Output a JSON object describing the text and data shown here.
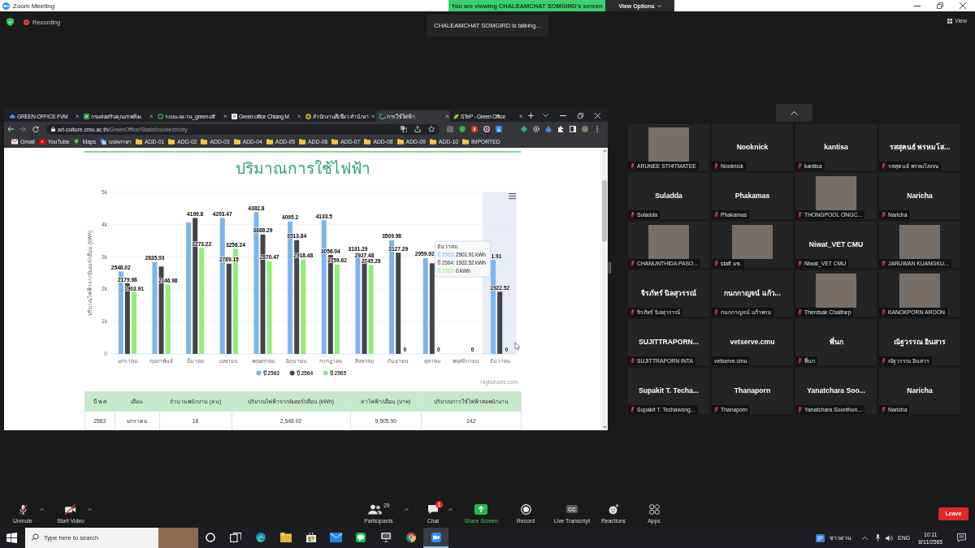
{
  "window": {
    "title": "Zoom Meeting"
  },
  "share_banner": {
    "text": "You are viewing CHALEAMCHAT SOMGIRD's screen",
    "view_options": "View Options"
  },
  "meeting_bar": {
    "recording": "Recording",
    "talking": "CHALEAMCHAT SOMGIRD is talking...",
    "view": "View"
  },
  "browser": {
    "tabs": [
      {
        "title": "GREEN OFFICE FVM",
        "selected": false
      },
      {
        "title": "กรมส่งเสริมคุณภาพสิ่งแ",
        "selected": false
      },
      {
        "title": "ระบบ-ลง-วน_green-off",
        "selected": false
      },
      {
        "title": "Green office Chiang M",
        "selected": false
      },
      {
        "title": "สำนักงานสีเขียว สำนักงา",
        "selected": false
      },
      {
        "title": "การใช้ไฟฟ้า",
        "selected": true
      },
      {
        "title": "STeP - Green Office",
        "selected": false
      }
    ],
    "address": {
      "host": "art-culture.cmu.ac.th",
      "path": "/GreenOffice/Statistics/electricity"
    },
    "bookmarks": [
      {
        "label": "Gmail",
        "kind": "mail"
      },
      {
        "label": "YouTube",
        "kind": "video"
      },
      {
        "label": "Maps",
        "kind": "map"
      },
      {
        "label": "แปลภาษา",
        "kind": "translate"
      },
      {
        "label": "ADD-01",
        "kind": "folder"
      },
      {
        "label": "ADD-02",
        "kind": "folder"
      },
      {
        "label": "ADD-03",
        "kind": "folder"
      },
      {
        "label": "ADD-04",
        "kind": "folder"
      },
      {
        "label": "ADD-05",
        "kind": "folder"
      },
      {
        "label": "ADD-06",
        "kind": "folder"
      },
      {
        "label": "ADD-07",
        "kind": "folder"
      },
      {
        "label": "ADD-08",
        "kind": "folder"
      },
      {
        "label": "ADD-09",
        "kind": "folder"
      },
      {
        "label": "ADD-10",
        "kind": "folder"
      },
      {
        "label": "IMPORTED",
        "kind": "folder"
      }
    ]
  },
  "page": {
    "heading": "ปริมาณการใช้ไฟฟ้า",
    "chart": {
      "chart_data": {
        "type": "bar",
        "orientation": "vertical",
        "ylabel": "ปริมาณไฟฟ้าจากมิเตอร์/เดือน (kWh)",
        "categories": [
          "มกราคม",
          "กุมภาพันธ์",
          "มีนาคม",
          "เมษายน",
          "พฤษภาคม",
          "มิถุนายน",
          "กรกฎาคม",
          "สิงหาคม",
          "กันยายน",
          "ตุลาคม",
          "พฤศจิกายน",
          "ธันวาคม"
        ],
        "series": [
          {
            "name": "ปี 2563",
            "color": "#7cb5ec",
            "values": [
              2548.02,
              2835.93,
              4060,
              4203.47,
              4382.8,
              4095.2,
              4133.5,
              3131.29,
              3509.98,
              2959.92,
              null,
              2901.91
            ]
          },
          {
            "name": "ปี 2564",
            "color": "#434348",
            "values": [
              2179.98,
              2700,
              4199.8,
              2789.15,
              3688.29,
              3513.84,
              3056.04,
              2927.48,
              3127.29,
              2800,
              null,
              1922.52
            ]
          },
          {
            "name": "ปี 2565",
            "color": "#90ed7d",
            "values": [
              1903.91,
              2146.98,
              3273.22,
              3256.24,
              2870.47,
              2918.48,
              2759.62,
              2745.29,
              0,
              0,
              0,
              0
            ]
          }
        ],
        "value_labels": [
          [
            "2548.02",
            "2835.93",
            null,
            "4203.47",
            "4382.8",
            "4095.2",
            "4133.5",
            "3131.29",
            "3509.98",
            "2959.92",
            null,
            "1.91"
          ],
          [
            "2179.98",
            null,
            "4199.8",
            "2789.15",
            "3688.29",
            "3513.84",
            "3056.04",
            "2927.48",
            "3127.29",
            null,
            null,
            "1922.52"
          ],
          [
            "1903.91",
            "2146.98",
            "3273.22",
            "3256.24",
            "2870.47",
            "2918.48",
            "2759.62",
            "2745.29",
            "0",
            "0",
            "0",
            "0"
          ]
        ],
        "ylim": [
          0,
          5000
        ],
        "yticks": [
          {
            "value": 0,
            "label": "0"
          },
          {
            "value": 1000,
            "label": "1k"
          },
          {
            "value": 2000,
            "label": "2k"
          },
          {
            "value": 3000,
            "label": "3k"
          },
          {
            "value": 4000,
            "label": "4k"
          },
          {
            "value": 5000,
            "label": "5k"
          }
        ],
        "grid": true,
        "legend": true
      },
      "columns": [
        {
          "hovered": false
        },
        {
          "hovered": false
        },
        {
          "hovered": false
        },
        {
          "hovered": false
        },
        {
          "hovered": false
        },
        {
          "hovered": false
        },
        {
          "hovered": false
        },
        {
          "hovered": false
        },
        {
          "hovered": false
        },
        {
          "hovered": false
        },
        {
          "hovered": false
        },
        {
          "hovered": true
        }
      ],
      "tooltip": {
        "title": "ธันวาคม",
        "rows": [
          {
            "label": "ปี 2563:",
            "value": "2901.91 kWh"
          },
          {
            "label": "ปี 2564:",
            "value": "1922.52 kWh"
          },
          {
            "label": "ปี 2565:",
            "value": "0 kWh"
          }
        ]
      },
      "credits": "Highcharts.com"
    },
    "table": {
      "columns": [
        "ปี พ.ศ",
        "เดือน",
        "จำนวนพนักงาน (คน)",
        "ปริมาณไฟฟ้าจากมิเตอร์/เดือน (kWh)",
        "ค่าไฟฟ้า/เดือน (บาท)",
        "ปริมาณการใช้ไฟฟ้าต่อพนักงาน"
      ],
      "rows": [
        [
          "2563",
          "มกราคม",
          "18",
          "2,548.02",
          "9,505.90",
          "142"
        ]
      ]
    }
  },
  "gallery": {
    "tiles": [
      {
        "name": "ARUNEE STHITMATEE",
        "video": true,
        "muted": true
      },
      {
        "title": "Nooknick",
        "name": "Nooknick",
        "video": false,
        "muted": true
      },
      {
        "title": "kantisa",
        "name": "kantisa",
        "video": false,
        "muted": true
      },
      {
        "title": "รสสุคนธ์ พรหมโส...",
        "name": "รสสุคนธ์ พรหมโสภณ",
        "video": false,
        "muted": true
      },
      {
        "title": "Suladda",
        "name": "Suladda",
        "video": false,
        "muted": true
      },
      {
        "title": "Phakamas",
        "name": "Phakamas",
        "video": false,
        "muted": true
      },
      {
        "name": "THONGPOOL ONGC...",
        "video": true,
        "muted": true
      },
      {
        "title": "Naricha",
        "name": "Naricha",
        "video": false,
        "muted": true
      },
      {
        "name": "CHANUNTHIDA PASO...",
        "video": true,
        "muted": true
      },
      {
        "name": "staff มช.",
        "video": true,
        "muted": true
      },
      {
        "title": "Niwat_VET CMU",
        "name": "Niwat_VET CMU",
        "video": false,
        "muted": true
      },
      {
        "name": "JARUWAN KUANGKU...",
        "video": true,
        "muted": true
      },
      {
        "title": "จิรภัทร์ นิลสุวรรณ์",
        "name": "จิรภัทร์ นิลสุวรรณ์",
        "video": false,
        "muted": true
      },
      {
        "title": "กนกกาญจน์ แก้ว...",
        "name": "กนกกาญจน์ แก้วพรม",
        "video": false,
        "muted": true
      },
      {
        "name": "Therdsak Chaithep",
        "video": true,
        "muted": true
      },
      {
        "name": "KANOKPORN AROON",
        "video": true,
        "muted": true
      },
      {
        "title": "SUJITTRAPORN...",
        "name": "SUJITTRAPORN INTA",
        "video": false,
        "muted": true
      },
      {
        "title": "vetserve.cmu",
        "name": "vetserve.cmu",
        "video": false,
        "muted": false
      },
      {
        "title": "พี่นก",
        "name": "พี่นก",
        "video": false,
        "muted": true
      },
      {
        "title": "ณัฐวรรณ อินสาร",
        "name": "ณัฐวรรณ อินสาร",
        "video": false,
        "muted": true
      },
      {
        "title": "Supakit T. Techa...",
        "name": "Supakit T. Techawong...",
        "video": false,
        "muted": true
      },
      {
        "title": "Thanaporn",
        "name": "Thanaporn",
        "video": false,
        "muted": true
      },
      {
        "title": "Yanatchara Soo...",
        "name": "Yanatchara Soonthon...",
        "video": false,
        "muted": true
      },
      {
        "title": "Naricha",
        "name": "Naricha",
        "video": false,
        "muted": true
      }
    ]
  },
  "toolbar": {
    "items": [
      {
        "label": "Unmute",
        "kind": "mic",
        "caret": true
      },
      {
        "label": "Start Video",
        "kind": "video",
        "caret": true
      },
      {
        "label": "Participants",
        "kind": "participants",
        "count": "29",
        "caret": true
      },
      {
        "label": "Chat",
        "kind": "chat",
        "badge": "1",
        "caret": true
      },
      {
        "label": "Share Screen",
        "kind": "share",
        "caret": false
      },
      {
        "label": "Record",
        "kind": "record",
        "caret": false
      },
      {
        "label": "Live Transcript",
        "kind": "transcript",
        "icon_text": "CC",
        "caret": false
      },
      {
        "label": "Reactions",
        "kind": "reactions",
        "caret": false
      },
      {
        "label": "Apps",
        "kind": "apps",
        "caret": false
      }
    ],
    "leave": "Leave"
  },
  "taskbar": {
    "search": {
      "placeholder": "Type here to search"
    },
    "apps": [
      {
        "kind": "cortana",
        "selected": false
      },
      {
        "kind": "task_view",
        "selected": false
      },
      {
        "kind": "edge",
        "selected": false
      },
      {
        "kind": "explorer",
        "selected": false
      },
      {
        "kind": "store",
        "selected": false
      },
      {
        "kind": "mail",
        "selected": false
      },
      {
        "kind": "line",
        "selected": false
      },
      {
        "kind": "app",
        "selected": false
      },
      {
        "kind": "chrome",
        "selected": false
      },
      {
        "kind": "zoom",
        "selected": true
      }
    ],
    "news": "ข่าวด่วน",
    "language": "ENG",
    "time": "10:11",
    "date": "8/11/2565"
  }
}
